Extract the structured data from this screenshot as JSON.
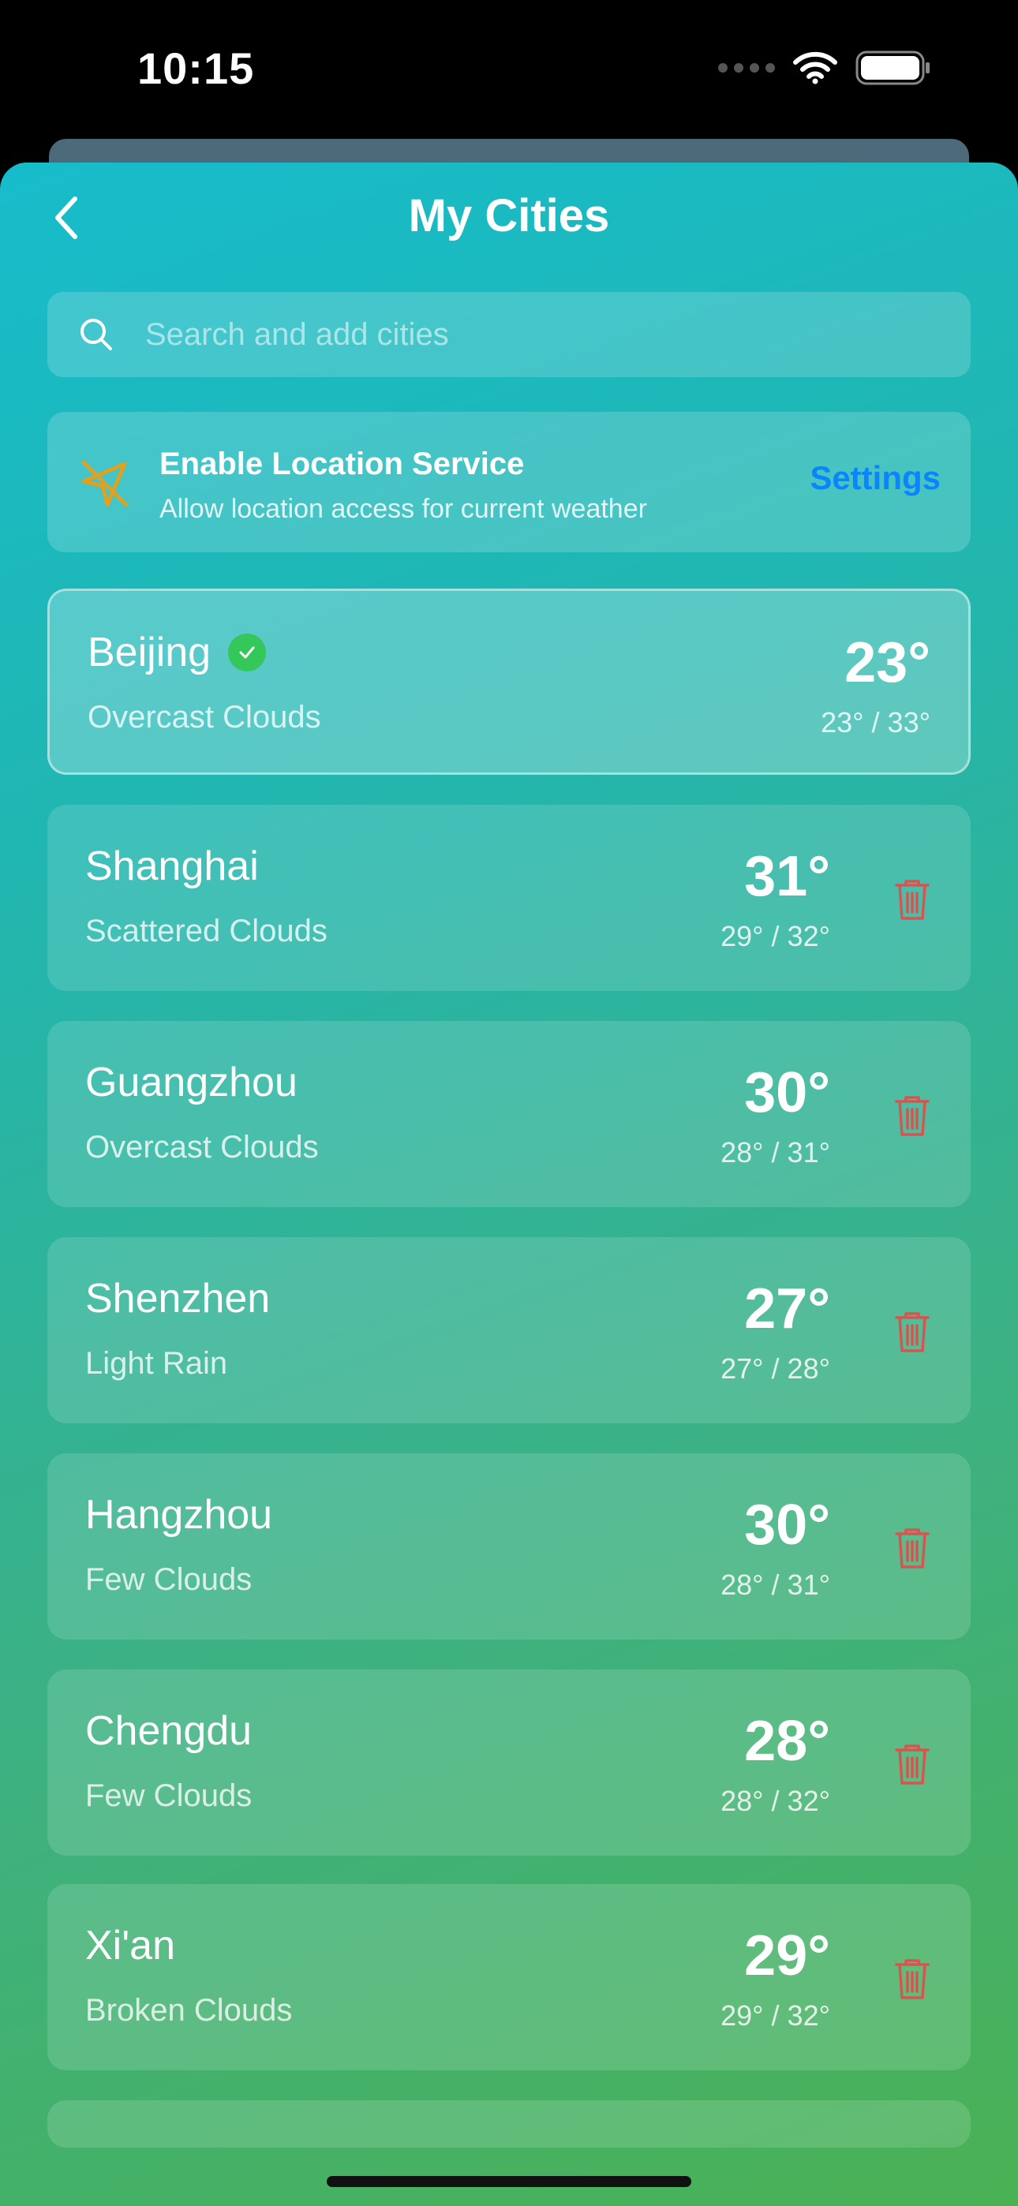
{
  "status_bar": {
    "time": "10:15"
  },
  "header": {
    "title": "My Cities"
  },
  "search": {
    "placeholder": "Search and add cities"
  },
  "location_service": {
    "title": "Enable Location Service",
    "subtitle": "Allow location access for current weather",
    "action": "Settings"
  },
  "cities": [
    {
      "name": "Beijing",
      "description": "Overcast Clouds",
      "temp": "23°",
      "range": "23° / 33°",
      "current": true
    },
    {
      "name": "Shanghai",
      "description": "Scattered Clouds",
      "temp": "31°",
      "range": "29° / 32°"
    },
    {
      "name": "Guangzhou",
      "description": "Overcast Clouds",
      "temp": "30°",
      "range": "28° / 31°"
    },
    {
      "name": "Shenzhen",
      "description": "Light Rain",
      "temp": "27°",
      "range": "27° / 28°"
    },
    {
      "name": "Hangzhou",
      "description": "Few Clouds",
      "temp": "30°",
      "range": "28° / 31°"
    },
    {
      "name": "Chengdu",
      "description": "Few Clouds",
      "temp": "28°",
      "range": "28° / 32°"
    },
    {
      "name": "Xi'an",
      "description": "Broken Clouds",
      "temp": "29°",
      "range": "29° / 32°"
    }
  ],
  "colors": {
    "accent": "#0a84ff",
    "check": "#34c759",
    "delete": "#d9534f",
    "location": "#e0a020"
  },
  "icons": [
    "chevron-left-icon",
    "search-icon",
    "location-off-icon",
    "checkmark-icon",
    "trash-icon"
  ]
}
